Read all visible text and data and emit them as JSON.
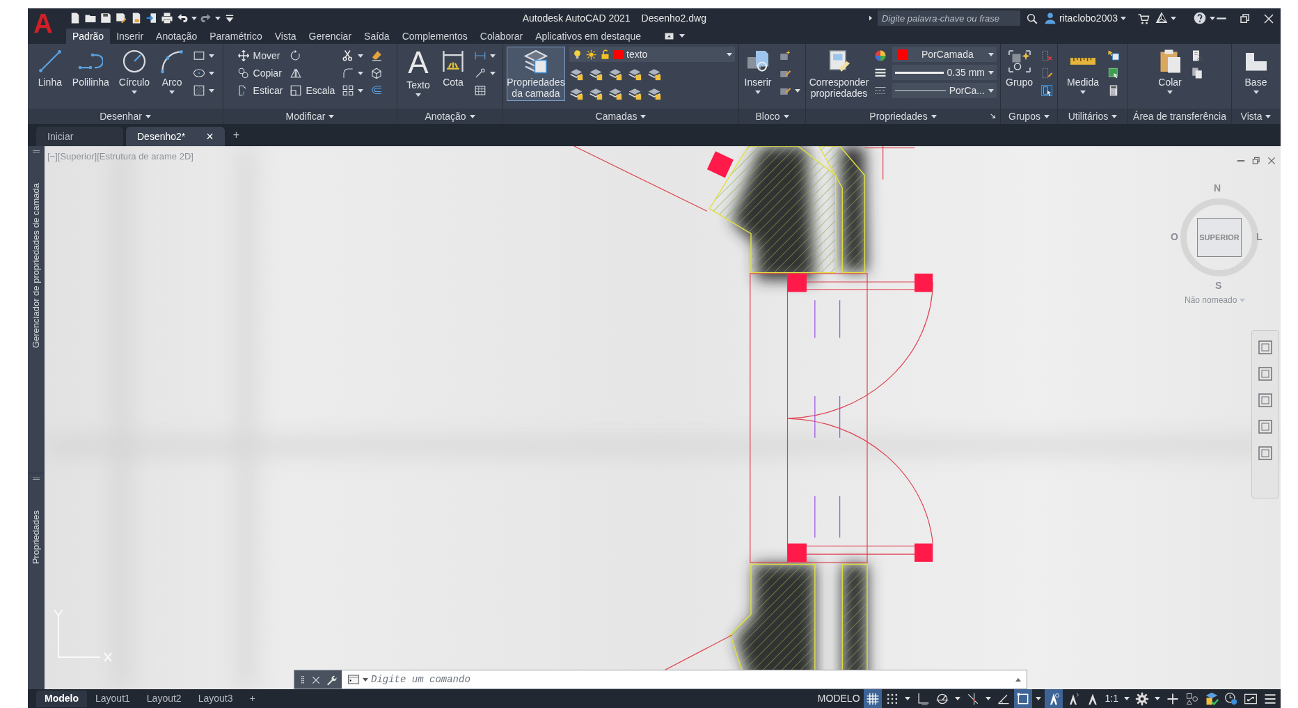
{
  "app": {
    "logo": "A",
    "title": "Autodesk AutoCAD 2021",
    "file": "Desenho2.dwg"
  },
  "quick_access": [
    {
      "dropdown": false
    },
    {
      "dropdown": false
    },
    {
      "dropdown": false
    },
    {
      "dropdown": false
    },
    {
      "dropdown": false
    },
    {
      "dropdown": false
    },
    {
      "dropdown": false
    },
    {
      "dropdown": true
    },
    {
      "dropdown": true
    },
    {
      "dropdown": false
    }
  ],
  "search": {
    "placeholder": "Digite palavra-chave ou frase"
  },
  "user": {
    "name": "ritaclobo2003"
  },
  "ribbon_tabs": [
    {
      "label": "Padrão",
      "selected": true
    },
    {
      "label": "Inserir",
      "selected": false
    },
    {
      "label": "Anotação",
      "selected": false
    },
    {
      "label": "Paramétrico",
      "selected": false
    },
    {
      "label": "Vista",
      "selected": false
    },
    {
      "label": "Gerenciar",
      "selected": false
    },
    {
      "label": "Saída",
      "selected": false
    },
    {
      "label": "Complementos",
      "selected": false
    },
    {
      "label": "Colaborar",
      "selected": false
    },
    {
      "label": "Aplicativos em destaque",
      "selected": false
    }
  ],
  "panels": [
    {
      "title": "Desenhar",
      "menu": true,
      "launcher": false,
      "tools": [
        {
          "kind": "large",
          "label": "Linha",
          "dropdown": false,
          "selected": false
        },
        {
          "kind": "large",
          "label": "Polilinha",
          "dropdown": false,
          "selected": false
        },
        {
          "kind": "large",
          "label": "Círculo",
          "dropdown": true,
          "selected": false
        },
        {
          "kind": "large",
          "label": "Arco",
          "dropdown": true,
          "selected": false
        },
        {
          "kind": "column",
          "items": [
            {
              "dropdown": true
            },
            {
              "dropdown": true
            },
            {
              "dropdown": true
            }
          ]
        }
      ]
    },
    {
      "title": "Modificar",
      "menu": true,
      "launcher": false,
      "tools": [
        {
          "kind": "column",
          "items": [
            {
              "label": "Mover",
              "dropdown": false
            },
            {
              "label": "Copiar",
              "dropdown": false
            },
            {
              "label": "Esticar",
              "dropdown": false
            }
          ]
        },
        {
          "kind": "column",
          "items": [
            {
              "dropdown": false
            },
            {
              "dropdown": false
            },
            {
              "label": "Escala",
              "dropdown": false
            }
          ]
        },
        {
          "kind": "column",
          "items": [
            {
              "dropdown": true
            },
            {
              "dropdown": true
            },
            {
              "dropdown": true
            }
          ]
        },
        {
          "kind": "column",
          "items": [
            {
              "dropdown": false
            },
            {
              "dropdown": false
            },
            {
              "dropdown": false
            }
          ]
        }
      ]
    },
    {
      "title": "Anotação",
      "menu": true,
      "launcher": false,
      "tools": [
        {
          "kind": "large",
          "label": "Texto",
          "glyph": "A",
          "dropdown": true,
          "selected": false
        },
        {
          "kind": "large",
          "label": "Cota",
          "dropdown": false,
          "selected": false
        },
        {
          "kind": "column",
          "items": [
            {
              "dropdown": true
            },
            {
              "dropdown": true
            },
            {
              "dropdown": false
            }
          ]
        }
      ]
    },
    {
      "title": "Camadas",
      "menu": true,
      "launcher": false,
      "tools": [
        {
          "kind": "large",
          "label": "Propriedades da camada",
          "dropdown": false,
          "selected": true
        },
        {
          "kind": "layers",
          "value": "texto",
          "color": "#ff0000",
          "items": [
            {
              "dropdown": false
            },
            {
              "dropdown": false
            },
            {
              "dropdown": false
            },
            {
              "dropdown": false
            },
            {
              "dropdown": false
            },
            {
              "dropdown": false
            },
            {
              "dropdown": false
            },
            {
              "dropdown": false
            },
            {
              "dropdown": false
            },
            {
              "dropdown": false
            }
          ]
        }
      ]
    },
    {
      "title": "Bloco",
      "menu": true,
      "launcher": false,
      "tools": [
        {
          "kind": "large",
          "label": "Inserir",
          "dropdown": true,
          "selected": false
        },
        {
          "kind": "column",
          "items": [
            {
              "dropdown": false
            },
            {
              "dropdown": false
            },
            {
              "dropdown": true
            }
          ]
        }
      ]
    },
    {
      "title": "Propriedades",
      "menu": true,
      "launcher": true,
      "tools": [
        {
          "kind": "large",
          "label": "Corresponder propriedades",
          "dropdown": false,
          "selected": false
        },
        {
          "kind": "column",
          "items": [
            {
              "dropdown": false
            },
            {
              "dropdown": false
            },
            {
              "dropdown": false
            }
          ]
        },
        {
          "kind": "combos",
          "items": [
            {
              "kind": "color",
              "value": "PorCamada",
              "color": "#ff0000"
            },
            {
              "kind": "lineweight",
              "value": "0.35 mm"
            },
            {
              "kind": "linetype",
              "value": "PorCa..."
            }
          ]
        }
      ]
    },
    {
      "title": "Grupos",
      "menu": true,
      "launcher": false,
      "tools": [
        {
          "kind": "large",
          "label": "Grupo",
          "dropdown": false,
          "selected": false
        },
        {
          "kind": "column",
          "items": [
            {
              "dropdown": false
            },
            {
              "dropdown": false
            },
            {
              "dropdown": false
            }
          ]
        }
      ]
    },
    {
      "title": "Utilitários",
      "menu": true,
      "launcher": false,
      "tools": [
        {
          "kind": "large",
          "label": "Medida",
          "dropdown": true,
          "selected": false
        },
        {
          "kind": "column",
          "items": [
            {
              "dropdown": false
            },
            {
              "dropdown": false
            },
            {
              "dropdown": false
            }
          ]
        }
      ]
    },
    {
      "title": "Área de transferência",
      "menu": false,
      "launcher": false,
      "tools": [
        {
          "kind": "large",
          "label": "Colar",
          "dropdown": true,
          "selected": false
        },
        {
          "kind": "column",
          "items": [
            {
              "dropdown": false
            },
            {
              "dropdown": false
            }
          ]
        }
      ]
    },
    {
      "title": "Vista",
      "menu": true,
      "launcher": false,
      "tools": [
        {
          "kind": "large",
          "label": "Base",
          "dropdown": true,
          "selected": false
        }
      ]
    }
  ],
  "doc_tabs": [
    {
      "label": "Iniciar",
      "selected": false
    },
    {
      "label": "Desenho2*",
      "selected": true,
      "close": "×"
    }
  ],
  "new_tab": "+",
  "side_palettes": [
    "Gerenciador de propriedades de camada",
    "Propriedades"
  ],
  "viewport": {
    "label": "[−][Superior][Estrutura de arame 2D]"
  },
  "viewcube": {
    "face": "SUPERIOR",
    "north": "N",
    "south": "S",
    "east": "L",
    "west": "O",
    "view_name": "Não nomeado"
  },
  "command": {
    "placeholder": "Digite um comando"
  },
  "layouts": [
    {
      "label": "Modelo",
      "selected": true
    },
    {
      "label": "Layout1",
      "selected": false
    },
    {
      "label": "Layout2",
      "selected": false
    },
    {
      "label": "Layout3",
      "selected": false
    }
  ],
  "add_layout": "+",
  "status_items": [
    {
      "kind": "text",
      "label": "MODELO",
      "on": false
    },
    {
      "kind": "icon",
      "on": true
    },
    {
      "kind": "icon",
      "on": false
    },
    {
      "kind": "caret",
      "on": false
    },
    {
      "kind": "icon",
      "on": false
    },
    {
      "kind": "icon",
      "on": false
    },
    {
      "kind": "caret",
      "on": false
    },
    {
      "kind": "icon",
      "on": false
    },
    {
      "kind": "caret",
      "on": false
    },
    {
      "kind": "icon",
      "on": false
    },
    {
      "kind": "icon",
      "on": true
    },
    {
      "kind": "caret",
      "on": false
    },
    {
      "kind": "icon",
      "on": true
    },
    {
      "kind": "icon",
      "on": false
    },
    {
      "kind": "icon",
      "on": false
    },
    {
      "kind": "text",
      "label": "1:1",
      "on": false
    },
    {
      "kind": "caret",
      "on": false
    },
    {
      "kind": "icon",
      "on": false
    },
    {
      "kind": "caret",
      "on": false
    },
    {
      "kind": "icon",
      "on": false
    },
    {
      "kind": "icon",
      "on": false
    },
    {
      "kind": "icon",
      "on": false
    },
    {
      "kind": "icon",
      "on": false
    },
    {
      "kind": "icon",
      "on": false
    },
    {
      "kind": "icon",
      "on": false
    }
  ]
}
